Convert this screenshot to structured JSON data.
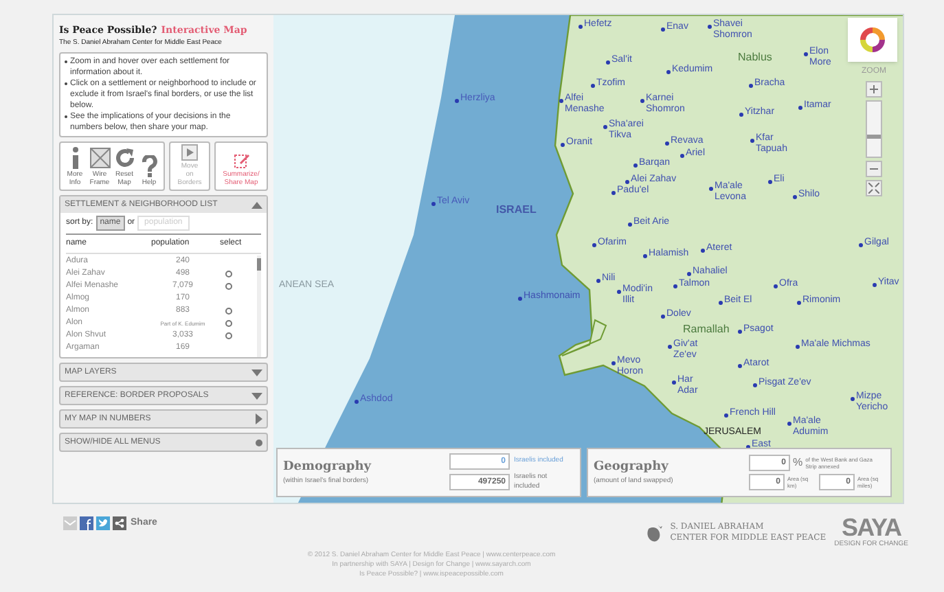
{
  "header": {
    "title": "Is Peace Possible?",
    "title_accent": "Interactive Map",
    "subtitle": "The S. Daniel Abraham Center for Middle East Peace"
  },
  "instructions": [
    "Zoom in and hover over each settlement for information about it.",
    "Click on a settlement or neighborhood to include or exclude it from Israel's final borders, or use the list below.",
    "See the implications of your decisions in the numbers below, then share your map."
  ],
  "tools": [
    {
      "label": "More Info",
      "kind": "info"
    },
    {
      "label": "Wire Frame",
      "kind": "wire"
    },
    {
      "label": "Reset Map",
      "kind": "reset"
    },
    {
      "label": "Help",
      "kind": "help"
    }
  ],
  "borders_button": {
    "label": "Move on Borders",
    "disabled": true
  },
  "share_button": {
    "label": "Summarize/ Share Map"
  },
  "list_panel": {
    "title": "SETTLEMENT & NEIGHBORHOOD LIST",
    "expanded": true,
    "sort_label": "sort by:",
    "sort_or": "or",
    "sort_options": [
      {
        "label": "name",
        "selected": true
      },
      {
        "label": "population",
        "selected": false
      }
    ],
    "columns": [
      "name",
      "population",
      "select"
    ],
    "rows": [
      {
        "name": "Adura",
        "population": "240",
        "selectable": false
      },
      {
        "name": "Alei Zahav",
        "population": "498",
        "selectable": true
      },
      {
        "name": "Alfei Menashe",
        "population": "7,079",
        "selectable": true
      },
      {
        "name": "Almog",
        "population": "170",
        "selectable": false
      },
      {
        "name": "Almon",
        "population": "883",
        "selectable": true
      },
      {
        "name": "Alon",
        "population": "Part of K. Edumim",
        "selectable": true
      },
      {
        "name": "Alon Shvut",
        "population": "3,033",
        "selectable": true
      },
      {
        "name": "Argaman",
        "population": "169",
        "selectable": false
      }
    ]
  },
  "menus": [
    {
      "label": "MAP LAYERS",
      "kind": "dropdown"
    },
    {
      "label": "REFERENCE: BORDER PROPOSALS",
      "kind": "dropdown"
    },
    {
      "label": "MY MAP IN NUMBERS",
      "kind": "flyout"
    },
    {
      "label": "SHOW/HIDE ALL MENUS",
      "kind": "toggle"
    }
  ],
  "map": {
    "zoom": {
      "label": "ZOOM",
      "level": 0.35
    },
    "labels": [
      {
        "text": "Hefetz",
        "kind": "settlement"
      },
      {
        "text": "Enav",
        "kind": "settlement"
      },
      {
        "text": "Shavei Shomron",
        "kind": "settlement"
      },
      {
        "text": "Sal'it",
        "kind": "settlement"
      },
      {
        "text": "Kedumim",
        "kind": "settlement"
      },
      {
        "text": "Nablus",
        "kind": "palestinian"
      },
      {
        "text": "Elon More",
        "kind": "settlement"
      },
      {
        "text": "Tzofim",
        "kind": "settlement"
      },
      {
        "text": "Bracha",
        "kind": "settlement"
      },
      {
        "text": "Alfei Menashe",
        "kind": "settlement"
      },
      {
        "text": "Karnei Shomron",
        "kind": "settlement"
      },
      {
        "text": "Yitzhar",
        "kind": "settlement"
      },
      {
        "text": "Itamar",
        "kind": "settlement"
      },
      {
        "text": "Herzliya",
        "kind": "city"
      },
      {
        "text": "Sha'arei Tikva",
        "kind": "settlement"
      },
      {
        "text": "Oranit",
        "kind": "settlement"
      },
      {
        "text": "Revava",
        "kind": "settlement"
      },
      {
        "text": "Ariel",
        "kind": "settlement"
      },
      {
        "text": "Kfar Tapuah",
        "kind": "settlement"
      },
      {
        "text": "Barqan",
        "kind": "settlement"
      },
      {
        "text": "Alei Zahav",
        "kind": "settlement"
      },
      {
        "text": "Padu'el",
        "kind": "settlement"
      },
      {
        "text": "Eli",
        "kind": "settlement"
      },
      {
        "text": "Ma'ale Levona",
        "kind": "settlement"
      },
      {
        "text": "Shilo",
        "kind": "settlement"
      },
      {
        "text": "Tel Aviv",
        "kind": "city"
      },
      {
        "text": "ISRAEL",
        "kind": "country"
      },
      {
        "text": "Beit Arie",
        "kind": "settlement"
      },
      {
        "text": "Ofarim",
        "kind": "settlement"
      },
      {
        "text": "Halamish",
        "kind": "settlement"
      },
      {
        "text": "Ateret",
        "kind": "settlement"
      },
      {
        "text": "Gilgal",
        "kind": "settlement"
      },
      {
        "text": "Nahaliel",
        "kind": "settlement"
      },
      {
        "text": "ANEAN SEA",
        "kind": "sea"
      },
      {
        "text": "Nili",
        "kind": "settlement"
      },
      {
        "text": "Hashmonaim",
        "kind": "settlement"
      },
      {
        "text": "Modi'in Illit",
        "kind": "settlement"
      },
      {
        "text": "Talmon",
        "kind": "settlement"
      },
      {
        "text": "Ofra",
        "kind": "settlement"
      },
      {
        "text": "Yitav",
        "kind": "settlement"
      },
      {
        "text": "Beit El",
        "kind": "settlement"
      },
      {
        "text": "Rimonim",
        "kind": "settlement"
      },
      {
        "text": "Dolev",
        "kind": "settlement"
      },
      {
        "text": "Ramallah",
        "kind": "palestinian"
      },
      {
        "text": "Psagot",
        "kind": "settlement"
      },
      {
        "text": "Giv'at Ze'ev",
        "kind": "settlement"
      },
      {
        "text": "Ma'ale Michmas",
        "kind": "settlement"
      },
      {
        "text": "Mevo Horon",
        "kind": "settlement"
      },
      {
        "text": "Atarot",
        "kind": "settlement"
      },
      {
        "text": "Har Adar",
        "kind": "settlement"
      },
      {
        "text": "Pisgat Ze'ev",
        "kind": "settlement"
      },
      {
        "text": "Ashdod",
        "kind": "city"
      },
      {
        "text": "French Hill",
        "kind": "settlement"
      },
      {
        "text": "Mizpe Yericho",
        "kind": "settlement"
      },
      {
        "text": "JERUSALEM",
        "kind": "capital"
      },
      {
        "text": "Ma'ale Adumim",
        "kind": "settlement"
      },
      {
        "text": "East",
        "kind": "settlement"
      }
    ]
  },
  "demography": {
    "title": "Demography",
    "subtitle": "(within Israel's final borders)",
    "rows": [
      {
        "value": "0",
        "label": "Israelis included",
        "kind": "included"
      },
      {
        "value": "497250",
        "label": "Israelis not included",
        "kind": "excluded"
      }
    ]
  },
  "geography": {
    "title": "Geography",
    "subtitle": "(amount of land swapped)",
    "percent": {
      "value": "0",
      "unit": "%",
      "label": "of the West Bank and Gaza Strip annexed"
    },
    "areas": [
      {
        "value": "0",
        "label": "Area (sq km)"
      },
      {
        "value": "0",
        "label": "Area (sq miles)"
      }
    ]
  },
  "footer": {
    "share_label": "Share",
    "logo_line1": "S. DANIEL ABRAHAM",
    "logo_line2": "CENTER FOR MIDDLE EAST PEACE",
    "saya": "SAYA",
    "saya_tag": "DESIGN FOR CHANGE",
    "lines": [
      "© 2012 S. Daniel Abraham Center for Middle East Peace | www.centerpeace.com",
      "In partnership with SAYA | Design for Change | www.sayarch.com",
      "Is Peace Possible? | www.ispeacepossible.com"
    ]
  }
}
